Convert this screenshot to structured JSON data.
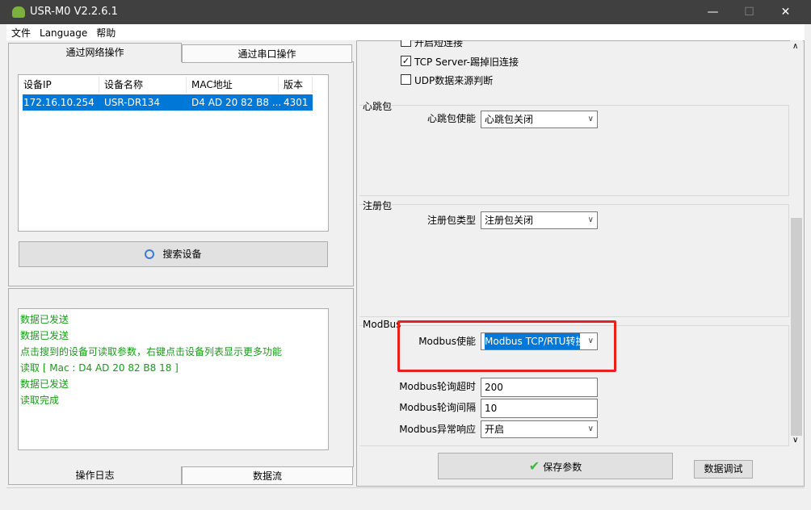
{
  "window": {
    "title": "USR-M0 V2.2.6.1",
    "minimize": "—",
    "maximize": "☐",
    "close": "✕"
  },
  "menu": [
    "文件",
    "Language",
    "帮助"
  ],
  "left": {
    "tabs": [
      "通过网络操作",
      "通过串口操作"
    ],
    "table": {
      "headers": [
        "设备IP",
        "设备名称",
        "MAC地址",
        "版本"
      ],
      "rows": [
        [
          "172.16.10.254",
          "USR-DR134",
          "D4 AD 20 82 B8 ...",
          "4301"
        ]
      ]
    },
    "search_button": "搜索设备",
    "log": [
      "数据已发送",
      "数据已发送",
      "点击搜到的设备可读取参数，右键点击设备列表显示更多功能",
      "读取 [ Mac : D4 AD 20 82 B8 18 ]",
      "数据已发送",
      "读取完成"
    ],
    "bottom_tabs": [
      "操作日志",
      "数据流"
    ]
  },
  "right": {
    "checkboxes": [
      {
        "label": "开启短连接",
        "checked": false
      },
      {
        "label": "TCP Server-踢掉旧连接",
        "checked": true
      },
      {
        "label": "UDP数据来源判断",
        "checked": false
      }
    ],
    "heartbeat": {
      "title": "心跳包",
      "label": "心跳包使能",
      "value": "心跳包关闭"
    },
    "register": {
      "title": "注册包",
      "label": "注册包类型",
      "value": "注册包关闭"
    },
    "modbus": {
      "title": "ModBus",
      "enable_label": "Modbus使能",
      "enable_value": "Modbus TCP/RTU转换",
      "timeout_label": "Modbus轮询超时",
      "timeout_value": "200",
      "interval_label": "Modbus轮询间隔",
      "interval_value": "10",
      "exception_label": "Modbus异常响应",
      "exception_value": "开启"
    },
    "save_button": "保存参数",
    "debug_button": "数据调试"
  },
  "colors": {
    "selection": "#0078d7",
    "log_text": "#1a9a1a",
    "highlight": "#e8221b"
  }
}
